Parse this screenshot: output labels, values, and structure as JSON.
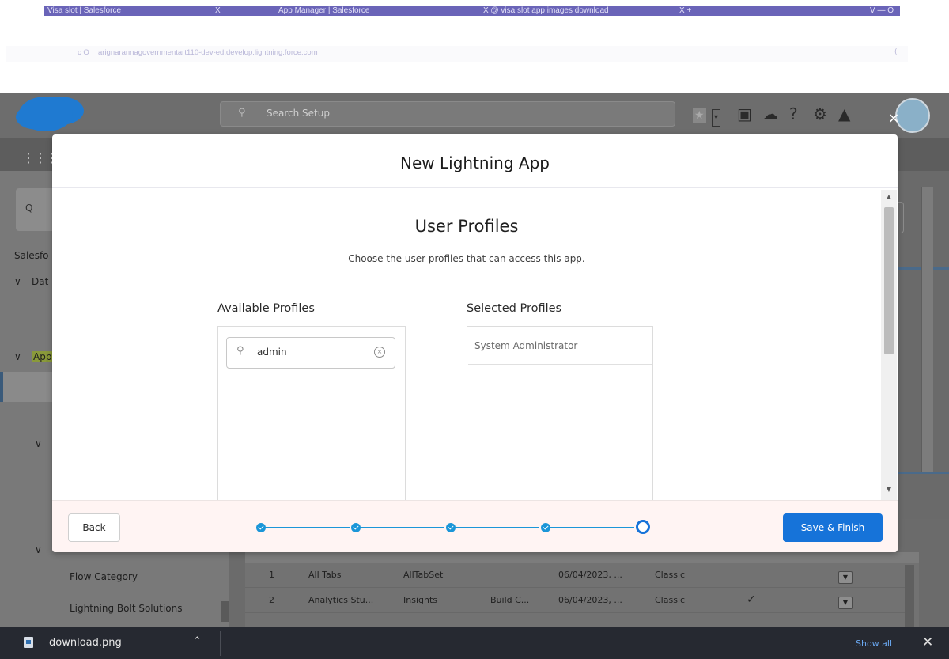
{
  "browser": {
    "tabs": [
      {
        "label": "Visa slot | Salesforce"
      },
      {
        "label": "X"
      },
      {
        "label": "App Manager | Salesforce"
      },
      {
        "label": "X @ visa slot app images download"
      },
      {
        "label": "X +"
      },
      {
        "label": "V — O"
      }
    ],
    "address_prefix": "c O",
    "url": "arignarannagovernmentart110-dev-ed.develop.lightning.force.com",
    "address_suffix": "("
  },
  "header": {
    "search_placeholder": "Search Setup",
    "icons": [
      "star-icon",
      "dropdown-icon",
      "plus-icon",
      "trailhead-icon",
      "help-icon",
      "gear-icon",
      "bell-icon"
    ]
  },
  "sidebar": {
    "search_glyph": "Q",
    "items": [
      {
        "label": "Salesfo"
      },
      {
        "label": "Dat"
      },
      {
        "label": "App"
      },
      {
        "label": "Flow Category"
      },
      {
        "label": "Lightning Bolt Solutions"
      }
    ]
  },
  "table": {
    "rows": [
      {
        "num": "1",
        "name": "All Tabs",
        "dev": "AllTabSet",
        "desc": "",
        "date": "06/04/2023, ...",
        "type": "Classic",
        "check": ""
      },
      {
        "num": "2",
        "name": "Analytics Stu...",
        "dev": "Insights",
        "desc": "Build C...",
        "date": "06/04/2023, ...",
        "type": "Classic",
        "check": "✓"
      }
    ]
  },
  "modal": {
    "title": "New Lightning App",
    "section_title": "User Profiles",
    "section_subtitle": "Choose the user profiles that can access this app.",
    "available_label": "Available Profiles",
    "selected_label": "Selected Profiles",
    "filter_value": "admin",
    "selected_profiles": [
      "System Administrator"
    ],
    "back_label": "Back",
    "save_label": "Save & Finish",
    "progress": {
      "total_steps": 5,
      "current_step": 5
    },
    "colors": {
      "primary": "#1673d9",
      "progress": "#1b96d8",
      "footer_bg": "#fff4f3"
    }
  },
  "downloads": {
    "file_name": "download.png",
    "show_all": "Show all"
  }
}
